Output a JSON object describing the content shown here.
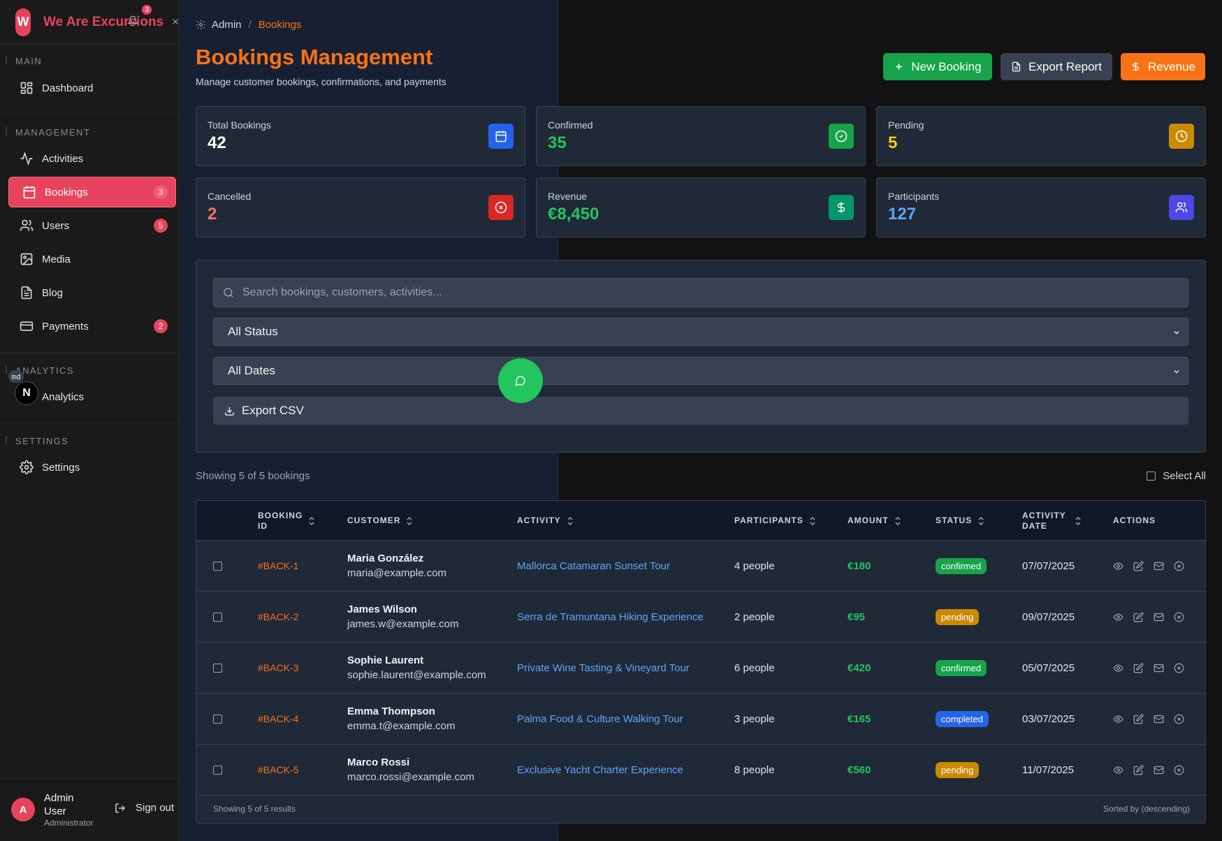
{
  "brand": {
    "mark": "W",
    "name": "We Are Excursions",
    "notif_count": "3"
  },
  "sidebar": {
    "sections": {
      "main": "MAIN",
      "management": "MANAGEMENT",
      "analytics": "ANALYTICS",
      "settings": "SETTINGS"
    },
    "items": [
      {
        "label": "Dashboard",
        "icon": "grid-icon"
      },
      {
        "label": "Activities",
        "icon": "activity-icon"
      },
      {
        "label": "Bookings",
        "icon": "calendar-icon",
        "badge": "3",
        "active": true
      },
      {
        "label": "Users",
        "icon": "users-icon",
        "badge": "5"
      },
      {
        "label": "Media",
        "icon": "image-icon"
      },
      {
        "label": "Blog",
        "icon": "file-text-icon"
      },
      {
        "label": "Payments",
        "icon": "credit-card-icon",
        "badge": "2"
      },
      {
        "label": "Analytics",
        "icon": "n-logo-icon"
      },
      {
        "label": "Settings",
        "icon": "gear-icon"
      }
    ],
    "dev_badge": "md",
    "n_logo": "N",
    "user": {
      "initial": "A",
      "name": "Admin User",
      "role": "Administrator"
    },
    "signout": "Sign out"
  },
  "breadcrumb": {
    "root": "Admin",
    "sep": "/",
    "current": "Bookings"
  },
  "header": {
    "title": "Bookings Management",
    "subtitle": "Manage customer bookings, confirmations, and payments",
    "buttons": {
      "new": "New Booking",
      "export": "Export Report",
      "revenue": "Revenue"
    }
  },
  "stats": [
    {
      "label": "Total Bookings",
      "value": "42",
      "color": "#ffffff",
      "icon_bg": "#2563eb",
      "icon": "calendar-icon"
    },
    {
      "label": "Confirmed",
      "value": "35",
      "color": "#22c55e",
      "icon_bg": "#16a34a",
      "icon": "check-circle-icon"
    },
    {
      "label": "Pending",
      "value": "5",
      "color": "#facc15",
      "icon_bg": "#ca8a04",
      "icon": "clock-icon"
    },
    {
      "label": "Cancelled",
      "value": "2",
      "color": "#f87171",
      "icon_bg": "#dc2626",
      "icon": "x-circle-icon"
    },
    {
      "label": "Revenue",
      "value": "€8,450",
      "color": "#22c55e",
      "icon_bg": "#059669",
      "icon": "dollar-icon"
    },
    {
      "label": "Participants",
      "value": "127",
      "color": "#60a5fa",
      "icon_bg": "#4f46e5",
      "icon": "users-icon"
    }
  ],
  "filters": {
    "search_placeholder": "Search bookings, customers, activities...",
    "status": "All Status",
    "dates": "All Dates",
    "export_csv": "Export CSV"
  },
  "list": {
    "showing": "Showing 5 of 5 bookings",
    "select_all": "Select All"
  },
  "table": {
    "columns": [
      "BOOKING ID",
      "CUSTOMER",
      "ACTIVITY",
      "PARTICIPANTS",
      "AMOUNT",
      "STATUS",
      "ACTIVITY DATE",
      "ACTIONS"
    ],
    "rows": [
      {
        "id": "#BACK-1",
        "name": "Maria González",
        "email": "maria@example.com",
        "activity": "Mallorca Catamaran Sunset Tour",
        "participants": "4 people",
        "amount": "€180",
        "status": "confirmed",
        "date": "07/07/2025"
      },
      {
        "id": "#BACK-2",
        "name": "James Wilson",
        "email": "james.w@example.com",
        "activity": "Serra de Tramuntana Hiking Experience",
        "participants": "2 people",
        "amount": "€95",
        "status": "pending",
        "date": "09/07/2025"
      },
      {
        "id": "#BACK-3",
        "name": "Sophie Laurent",
        "email": "sophie.laurent@example.com",
        "activity": "Private Wine Tasting & Vineyard Tour",
        "participants": "6 people",
        "amount": "€420",
        "status": "confirmed",
        "date": "05/07/2025"
      },
      {
        "id": "#BACK-4",
        "name": "Emma Thompson",
        "email": "emma.t@example.com",
        "activity": "Palma Food & Culture Walking Tour",
        "participants": "3 people",
        "amount": "€165",
        "status": "completed",
        "date": "03/07/2025"
      },
      {
        "id": "#BACK-5",
        "name": "Marco Rossi",
        "email": "marco.rossi@example.com",
        "activity": "Exclusive Yacht Charter Experience",
        "participants": "8 people",
        "amount": "€560",
        "status": "pending",
        "date": "11/07/2025"
      }
    ],
    "status_colors": {
      "confirmed": "#16a34a",
      "pending": "#ca8a04",
      "completed": "#2563eb"
    },
    "footer_left": "Showing 5 of 5 results",
    "footer_right": "Sorted by (descending)"
  }
}
